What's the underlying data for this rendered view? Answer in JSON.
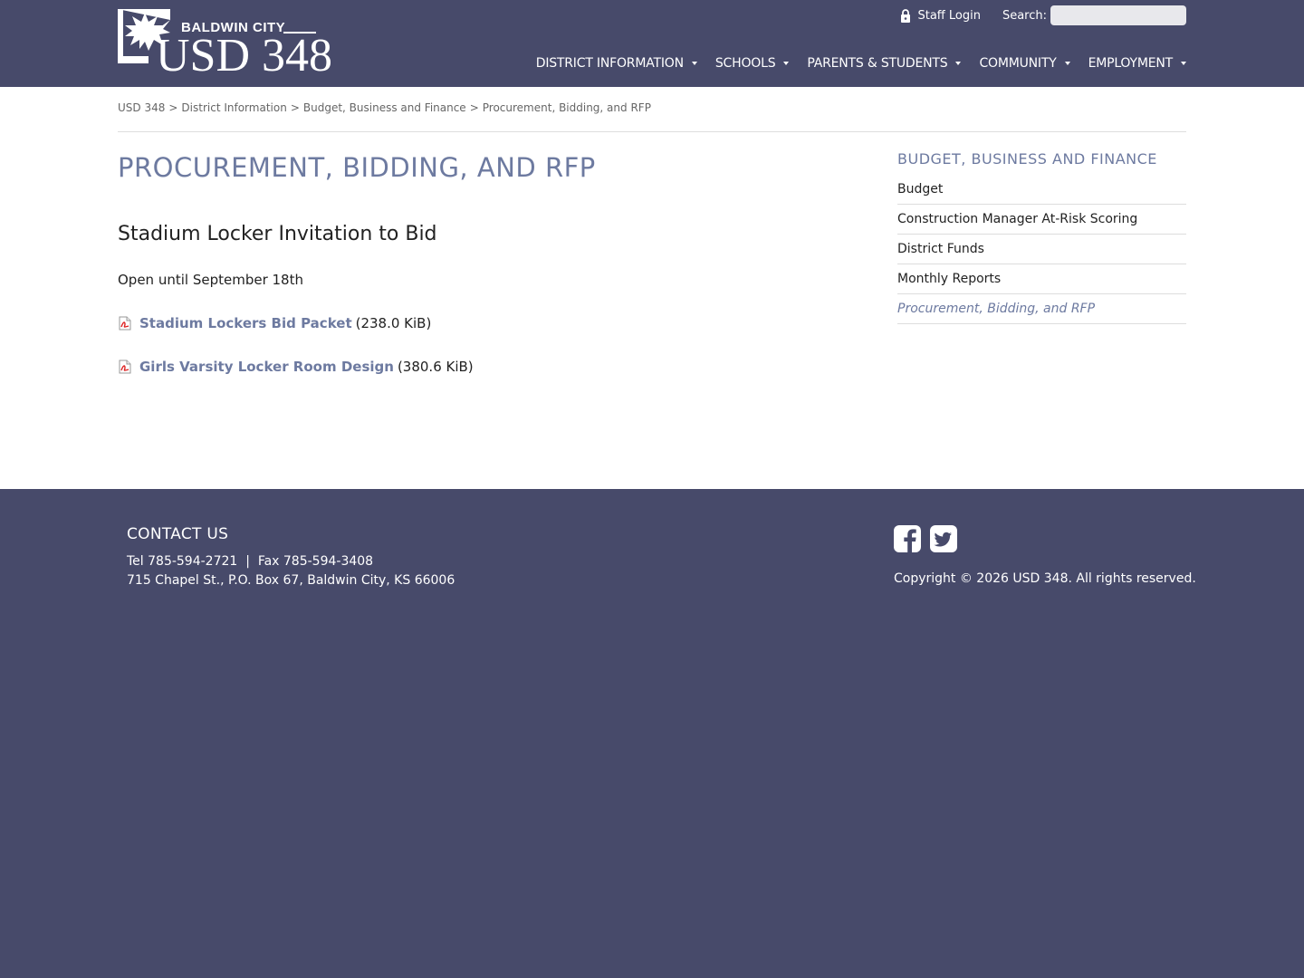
{
  "header": {
    "logo_small": "BALDWIN CITY",
    "logo_big": "USD 348",
    "staff_login": "Staff Login",
    "search_label": "Search:",
    "search_value": ""
  },
  "nav": [
    {
      "label": "DISTRICT INFORMATION"
    },
    {
      "label": "SCHOOLS"
    },
    {
      "label": "PARENTS & STUDENTS"
    },
    {
      "label": "COMMUNITY"
    },
    {
      "label": "EMPLOYMENT"
    }
  ],
  "breadcrumb": [
    {
      "label": "USD 348"
    },
    {
      "label": "District Information"
    },
    {
      "label": "Budget, Business and Finance"
    },
    {
      "label": "Procurement, Bidding, and RFP"
    }
  ],
  "breadcrumb_separator": ">",
  "page_title": "PROCUREMENT, BIDDING, AND RFP",
  "content": {
    "heading": "Stadium Locker Invitation to Bid",
    "text": "Open until September 18th",
    "files": [
      {
        "label": "Stadium Lockers Bid Packet",
        "size": "(238.0 KiB)"
      },
      {
        "label": "Girls Varsity Locker Room Design",
        "size": "(380.6 KiB)"
      }
    ]
  },
  "sidebar": {
    "title": "BUDGET, BUSINESS AND FINANCE",
    "items": [
      {
        "label": "Budget"
      },
      {
        "label": "Construction Manager At-Risk Scoring"
      },
      {
        "label": "District Funds"
      },
      {
        "label": "Monthly Reports"
      },
      {
        "label": "Procurement, Bidding, and RFP"
      }
    ]
  },
  "footer": {
    "contact_title": "CONTACT US",
    "phones": "Tel 785-594-2721  |  Fax 785-594-3408",
    "address": "715 Chapel St., P.O. Box 67, Baldwin City, KS 66006",
    "copyright": "Copyright © 2026 USD 348. All rights reserved."
  },
  "icons": [
    "lock-icon",
    "search-icon",
    "pdf-icon",
    "facebook-icon",
    "twitter-icon",
    "maple-leaf-logo-icon"
  ],
  "colors": {
    "brand": "#474a6a",
    "accent": "#6d7aa0"
  }
}
